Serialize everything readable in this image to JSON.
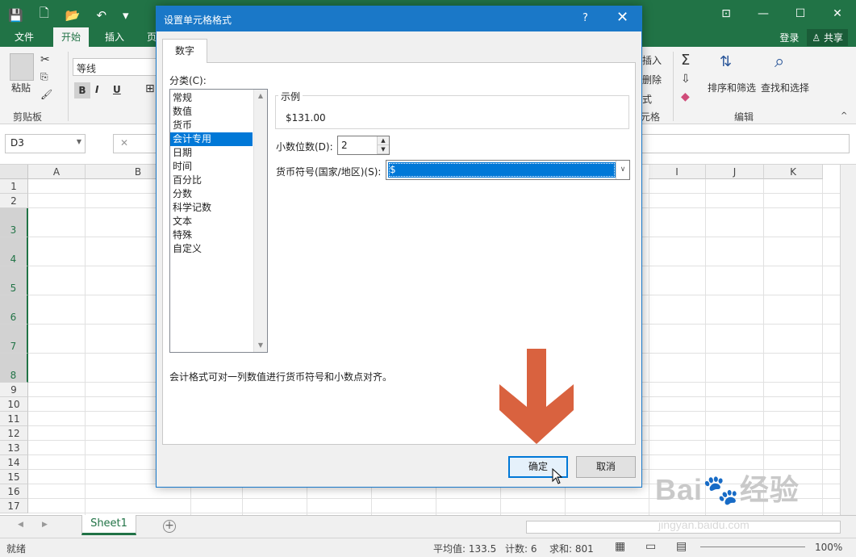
{
  "titlebar": {
    "qat": [
      "💾",
      "🗋",
      "📂",
      "↶",
      "▾"
    ],
    "window_controls": [
      "⊡",
      "—",
      "☐",
      "✕"
    ]
  },
  "ribbon_tabs": {
    "file": "文件",
    "home": "开始",
    "insert": "插入",
    "page_partial": "页",
    "login": "登录",
    "share": "共享"
  },
  "ribbon": {
    "paste_label": "粘贴",
    "clipboard_group": "剪贴板",
    "font_name": "等线",
    "bold": "B",
    "italic": "I",
    "underline": "U",
    "insert_partial": "插入",
    "delete_partial": "删除",
    "format_partial": "式",
    "cells_group_partial": "元格",
    "sort_filter": "排序和筛选",
    "find_select": "查找和选择",
    "edit_group": "编辑"
  },
  "formula_bar": {
    "name_box": "D3",
    "cancel": "✕"
  },
  "grid": {
    "columns": [
      {
        "label": "A"
      },
      {
        "label": "B"
      },
      {
        "label": "I"
      },
      {
        "label": "J"
      },
      {
        "label": "K"
      }
    ],
    "rows": [
      "1",
      "2",
      "3",
      "4",
      "5",
      "6",
      "7",
      "8",
      "9",
      "10",
      "11",
      "12",
      "13",
      "14",
      "15",
      "16",
      "17"
    ],
    "selected_rows": [
      "3",
      "4",
      "5",
      "6",
      "7",
      "8"
    ]
  },
  "sheets": {
    "active": "Sheet1",
    "add": "+"
  },
  "statusbar": {
    "ready": "就绪",
    "average": "平均值: 133.5",
    "count": "计数: 6",
    "sum": "求和: 801",
    "zoom": "100%"
  },
  "dialog": {
    "title": "设置单元格格式",
    "help": "?",
    "close": "✕",
    "tab": "数字",
    "category_label": "分类(C):",
    "categories": [
      "常规",
      "数值",
      "货币",
      "会计专用",
      "日期",
      "时间",
      "百分比",
      "分数",
      "科学记数",
      "文本",
      "特殊",
      "自定义"
    ],
    "selected_category": "会计专用",
    "sample_label": "示例",
    "sample_value": "$131.00",
    "decimal_label": "小数位数(D):",
    "decimal_value": "2",
    "currency_label": "货币符号(国家/地区)(S):",
    "currency_value": "$",
    "description": "会计格式可对一列数值进行货币符号和小数点对齐。",
    "ok": "确定",
    "cancel": "取消"
  },
  "overlay": {
    "arrow_color": "#d9623f",
    "watermark": "Bai🐾经验",
    "watermark_url": "jingyan.baidu.com"
  }
}
